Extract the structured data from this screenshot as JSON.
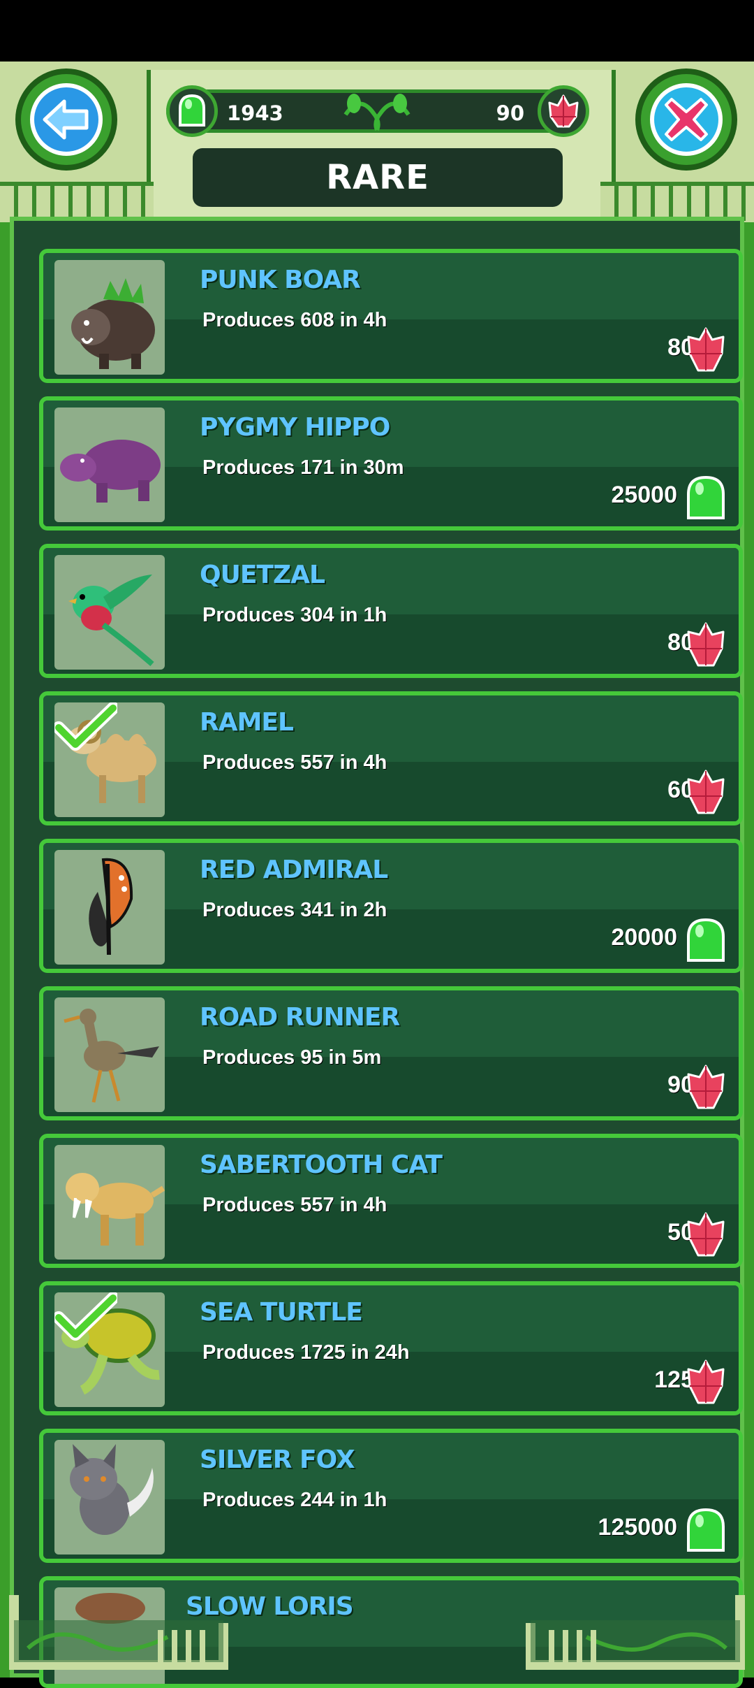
{
  "header": {
    "title": "RARE",
    "gel_count": "1943",
    "gem_count": "90"
  },
  "colors": {
    "name_text": "#5fc4ff",
    "card_border": "#45c93a",
    "gel": "#31d43a",
    "gem": "#e8425e"
  },
  "animals": [
    {
      "name": "PUNK BOAR",
      "produces": "Produces 608 in 4h",
      "price": "80",
      "currency": "gem-icon",
      "owned": false
    },
    {
      "name": "PYGMY HIPPO",
      "produces": "Produces 171 in 30m",
      "price": "25000",
      "currency": "gel-icon",
      "owned": false
    },
    {
      "name": "QUETZAL",
      "produces": "Produces 304 in 1h",
      "price": "80",
      "currency": "gem-icon",
      "owned": false
    },
    {
      "name": "RAMEL",
      "produces": "Produces 557 in 4h",
      "price": "60",
      "currency": "gem-icon",
      "owned": true
    },
    {
      "name": "RED ADMIRAL",
      "produces": "Produces 341 in 2h",
      "price": "20000",
      "currency": "gel-icon",
      "owned": false
    },
    {
      "name": "ROAD RUNNER",
      "produces": "Produces 95 in 5m",
      "price": "90",
      "currency": "gem-icon",
      "owned": false
    },
    {
      "name": "SABERTOOTH CAT",
      "produces": "Produces 557 in 4h",
      "price": "50",
      "currency": "gem-icon",
      "owned": false
    },
    {
      "name": "SEA TURTLE",
      "produces": "Produces 1725 in 24h",
      "price": "125",
      "currency": "gem-icon",
      "owned": true
    },
    {
      "name": "SILVER FOX",
      "produces": "Produces 244 in 1h",
      "price": "125000",
      "currency": "gel-icon",
      "owned": false
    }
  ],
  "partial_next": {
    "name": "SLOW LORIS"
  }
}
